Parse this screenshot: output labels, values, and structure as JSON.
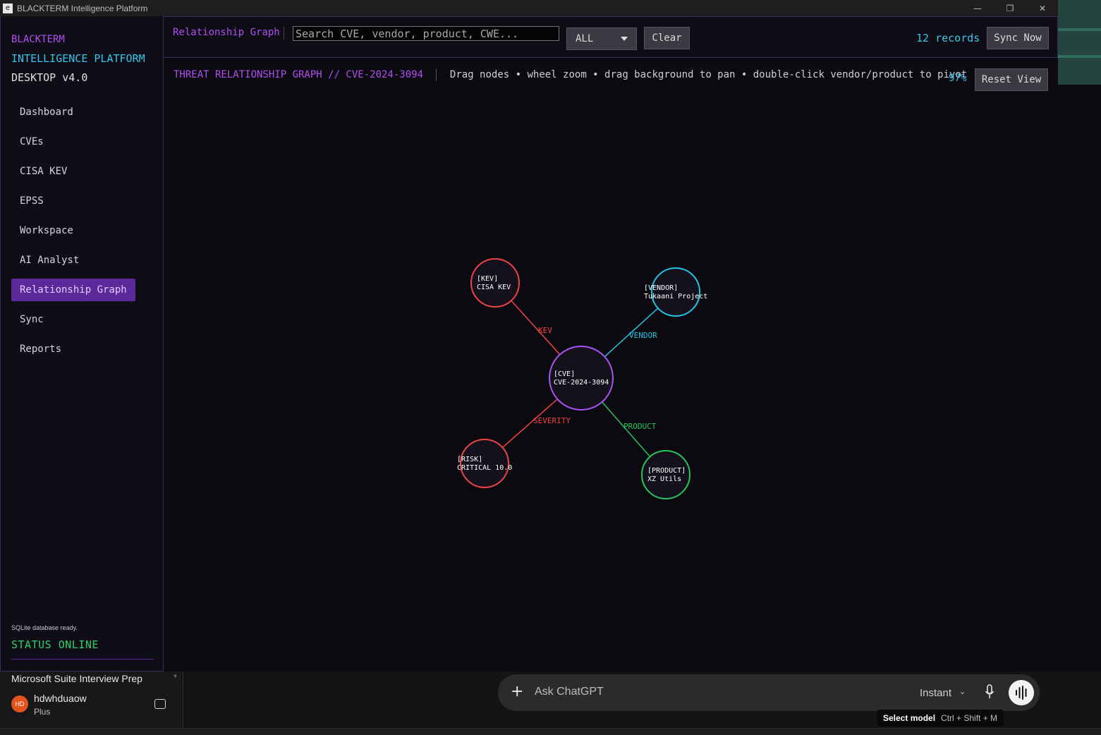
{
  "window": {
    "title": "BLACKTERM Intelligence Platform",
    "controls": [
      "—",
      "❐",
      "✕"
    ]
  },
  "sidebar": {
    "brand_line1": "BLACKTERM",
    "brand_line2": "INTELLIGENCE PLATFORM",
    "brand_line3": "DESKTOP v4.0",
    "items": [
      {
        "label": "Dashboard"
      },
      {
        "label": "CVEs"
      },
      {
        "label": "CISA KEV"
      },
      {
        "label": "EPSS"
      },
      {
        "label": "Workspace"
      },
      {
        "label": "AI Analyst"
      },
      {
        "label": "Relationship Graph",
        "active": true
      },
      {
        "label": "Sync"
      },
      {
        "label": "Reports"
      }
    ],
    "db_status": "SQLite database ready.",
    "status": "STATUS ONLINE"
  },
  "header": {
    "title": "Relationship Graph",
    "search_placeholder": "Search CVE, vendor, product, CWE...",
    "filter_value": "ALL",
    "clear_label": "Clear",
    "records": "12 records",
    "sync_label": "Sync Now"
  },
  "graph": {
    "title": "THREAT RELATIONSHIP GRAPH // CVE-2024-3094",
    "hint": "Drag nodes • wheel zoom • drag background to pan • double-click vendor/product to pivot",
    "zoom": "97%",
    "reset_label": "Reset View",
    "nodes": [
      {
        "id": "cve",
        "tag": "[CVE]",
        "label": "CVE-2024-3094",
        "color": "#a855f7"
      },
      {
        "id": "kev",
        "tag": "[KEV]",
        "label": "CISA KEV",
        "color": "#ef4444"
      },
      {
        "id": "vendor",
        "tag": "[VENDOR]",
        "label": "Tukaani Project",
        "color": "#22c5e0"
      },
      {
        "id": "risk",
        "tag": "[RISK]",
        "label": "CRITICAL 10.0",
        "color": "#ef4444"
      },
      {
        "id": "product",
        "tag": "[PRODUCT]",
        "label": "XZ Utils",
        "color": "#22c55e"
      }
    ],
    "edges": [
      {
        "from": "cve",
        "to": "kev",
        "label": "KEV",
        "color": "#ef4444"
      },
      {
        "from": "cve",
        "to": "vendor",
        "label": "VENDOR",
        "color": "#22c5e0"
      },
      {
        "from": "cve",
        "to": "risk",
        "label": "SEVERITY",
        "color": "#ef4444"
      },
      {
        "from": "cve",
        "to": "product",
        "label": "PRODUCT",
        "color": "#22c55e"
      }
    ]
  },
  "chat": {
    "conversation_title": "Microsoft Suite Interview Prep",
    "user_initials": "HD",
    "user_name": "hdwhduaow",
    "user_plan": "Plus",
    "ask_placeholder": "Ask ChatGPT",
    "model": "Instant",
    "tooltip_title": "Select model",
    "tooltip_keys": "Ctrl + Shift + M"
  }
}
